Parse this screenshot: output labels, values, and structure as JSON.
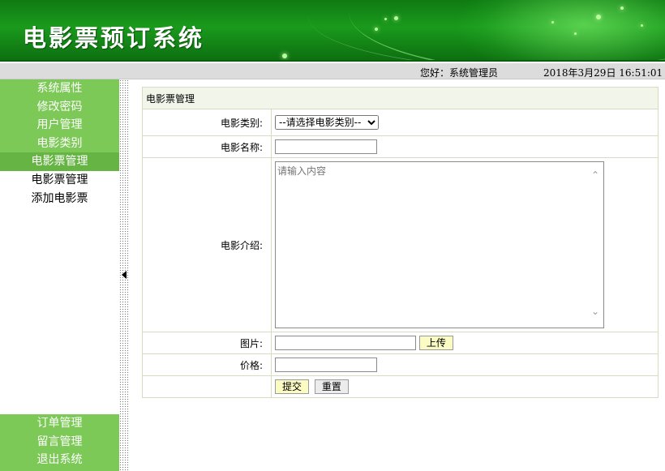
{
  "header": {
    "title": "电影票预订系统"
  },
  "infobar": {
    "greeting": "您好：系统管理员",
    "datetime": "2018年3月29日 16:51:01"
  },
  "sidebar": {
    "top_items": [
      {
        "label": "系统属性"
      },
      {
        "label": "修改密码"
      },
      {
        "label": "用户管理"
      },
      {
        "label": "电影类别"
      },
      {
        "label": "电影票管理"
      }
    ],
    "sub_items": [
      {
        "label": "电影票管理"
      },
      {
        "label": "添加电影票"
      }
    ],
    "bottom_items": [
      {
        "label": "订单管理"
      },
      {
        "label": "留言管理"
      },
      {
        "label": "退出系统"
      }
    ]
  },
  "form": {
    "caption": "电影票管理",
    "category_label": "电影类别:",
    "category_selected": "--请选择电影类别--",
    "name_label": "电影名称:",
    "name_value": "",
    "intro_label": "电影介绍:",
    "intro_placeholder": "请输入内容",
    "image_label": "图片:",
    "upload_button": "上传",
    "price_label": "价格:",
    "price_value": "",
    "submit_button": "提交",
    "reset_button": "重置"
  },
  "colors": {
    "brand_green": "#1a9a1c",
    "menu_green": "#7cc957",
    "highlight": "#fbfbc4"
  }
}
